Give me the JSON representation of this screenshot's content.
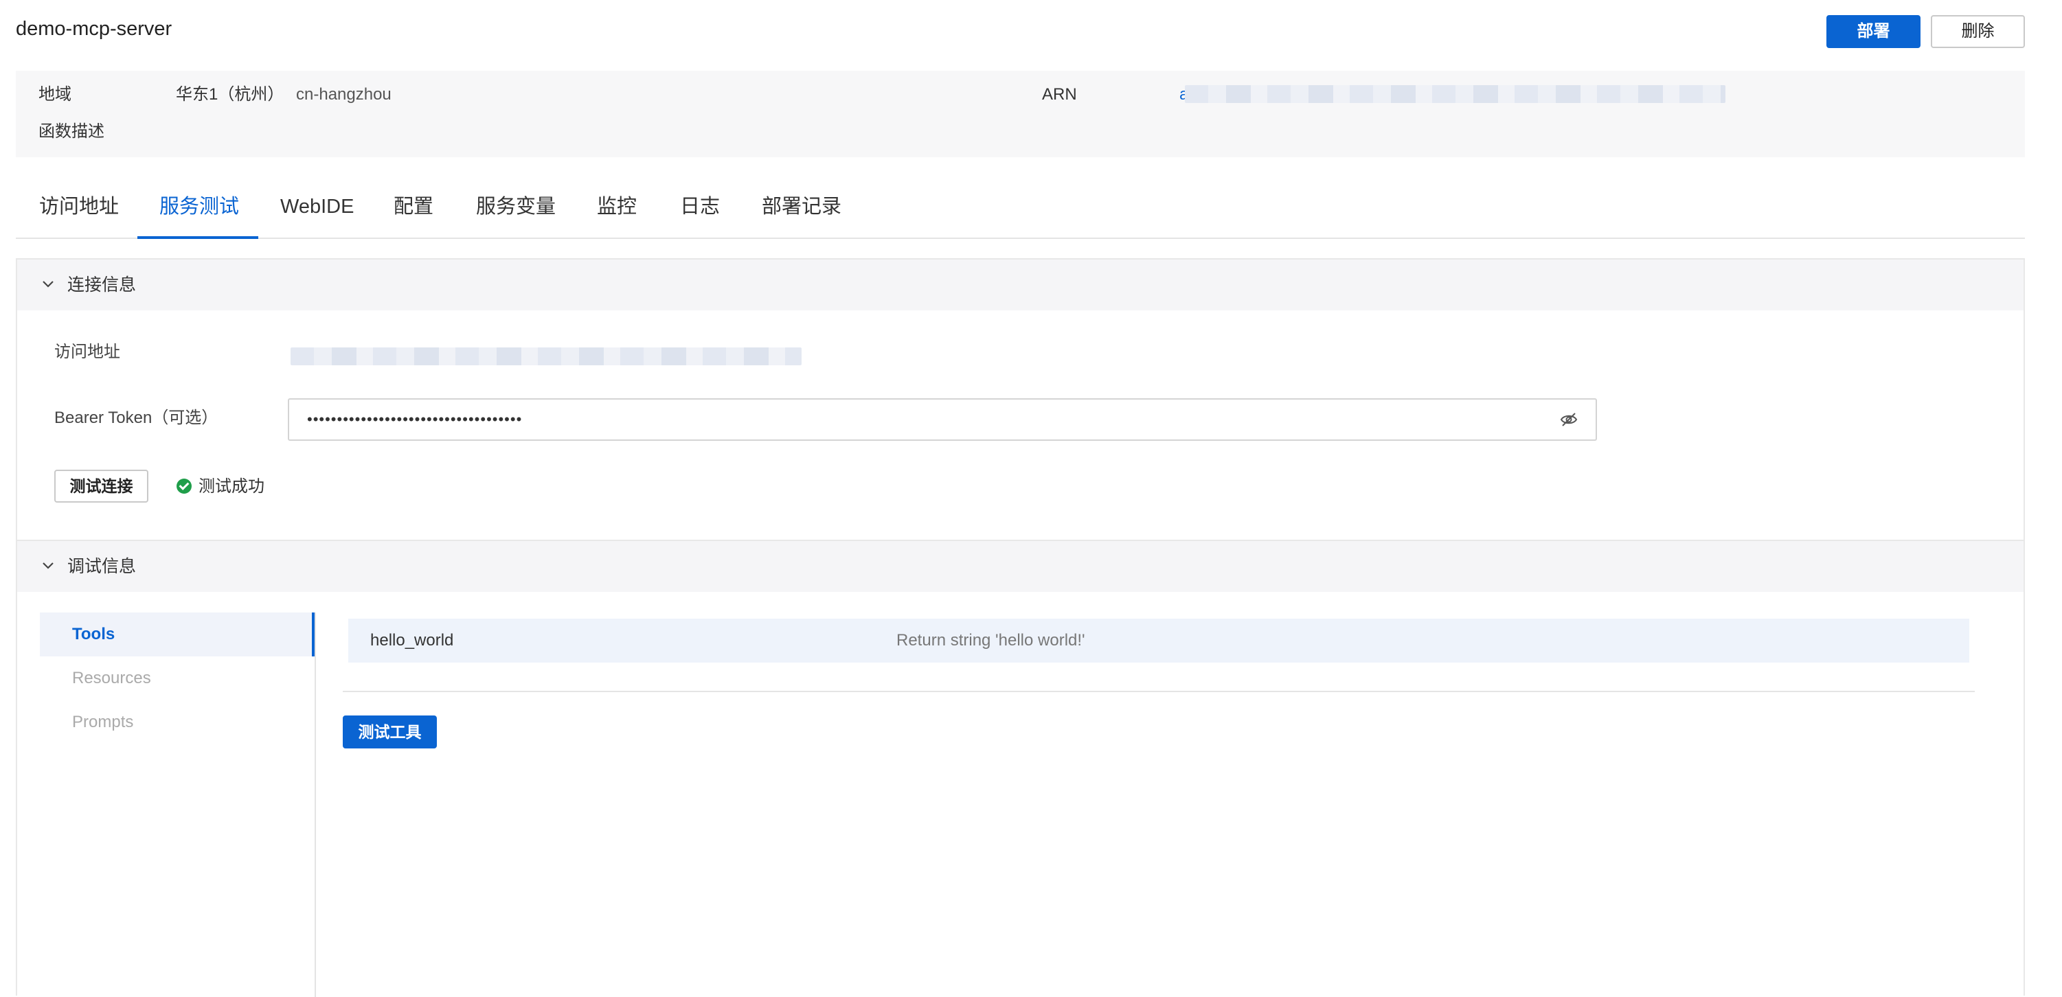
{
  "header": {
    "title": "demo-mcp-server",
    "deploy_label": "部署",
    "delete_label": "删除"
  },
  "info": {
    "region_label": "地域",
    "region_value": "华东1（杭州）",
    "region_id": "cn-hangzhou",
    "arn_label": "ARN",
    "arn_visible_start": "a",
    "description_label": "函数描述"
  },
  "tabs": [
    {
      "label": "访问地址"
    },
    {
      "label": "服务测试"
    },
    {
      "label": "WebIDE"
    },
    {
      "label": "配置"
    },
    {
      "label": "服务变量"
    },
    {
      "label": "监控"
    },
    {
      "label": "日志"
    },
    {
      "label": "部署记录"
    }
  ],
  "active_tab": "服务测试",
  "connection": {
    "section_title": "连接信息",
    "access_url_label": "访问地址",
    "token_label": "Bearer Token（可选）",
    "token_value": "••••••••••••••••••••••••••••••••••••",
    "test_button_label": "测试连接",
    "status_text": "测试成功"
  },
  "debug": {
    "section_title": "调试信息",
    "nav_items": [
      {
        "label": "Tools"
      },
      {
        "label": "Resources"
      },
      {
        "label": "Prompts"
      }
    ],
    "active_nav": "Tools",
    "tools": [
      {
        "name": "hello_world",
        "description": "Return string 'hello world!'"
      }
    ],
    "test_tool_label": "测试工具"
  },
  "colors": {
    "primary": "#0a64d2",
    "success": "#1f9e4a",
    "panel_bg": "#f7f7f8"
  }
}
